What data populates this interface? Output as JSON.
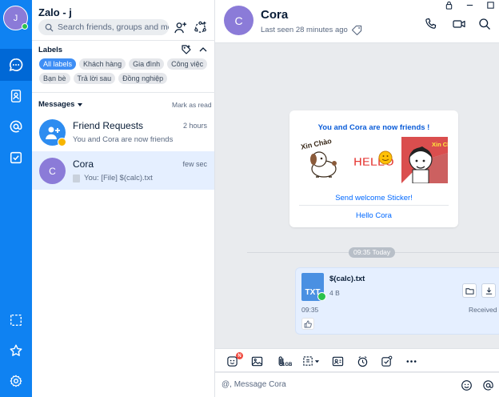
{
  "user": {
    "initial": "J"
  },
  "sidebar": {
    "title": "Zalo - j",
    "search_placeholder": "Search friends, groups and me...",
    "labels_title": "Labels",
    "labels": [
      "All labels",
      "Khách hàng",
      "Gia đình",
      "Công việc",
      "Bạn bè",
      "Trả lời sau",
      "Đồng nghiệp"
    ],
    "messages_title": "Messages",
    "mark_as_read": "Mark as read",
    "conversations": [
      {
        "name": "Friend Requests",
        "time": "2 hours",
        "preview": "You and Cora are now friends"
      },
      {
        "name": "Cora",
        "initial": "C",
        "time": "few sec",
        "preview": "You: [File] $(calc).txt"
      }
    ]
  },
  "chat": {
    "contact_name": "Cora",
    "contact_initial": "C",
    "status": "Last seen 28 minutes ago",
    "friend_card": {
      "title": "You and Cora are now friends !",
      "stickers": [
        "Xin Chào",
        "HELLO",
        "Xin Chào"
      ],
      "send_sticker": "Send welcome Sticker!",
      "hello": "Hello Cora"
    },
    "time_separator": "09:35 Today",
    "file_message": {
      "icon_text": "TXT",
      "name": "$(calc).txt",
      "size": "4 B",
      "time": "09:35",
      "status": "Received"
    },
    "toolbar": {
      "badge": "N",
      "file_size_label": "1GB"
    },
    "composer_placeholder": "@, Message Cora"
  },
  "colors": {
    "rail": "#0f82f2",
    "accent": "#0068ff",
    "bubble": "#e5efff",
    "avatar": "#8b7bd8"
  }
}
